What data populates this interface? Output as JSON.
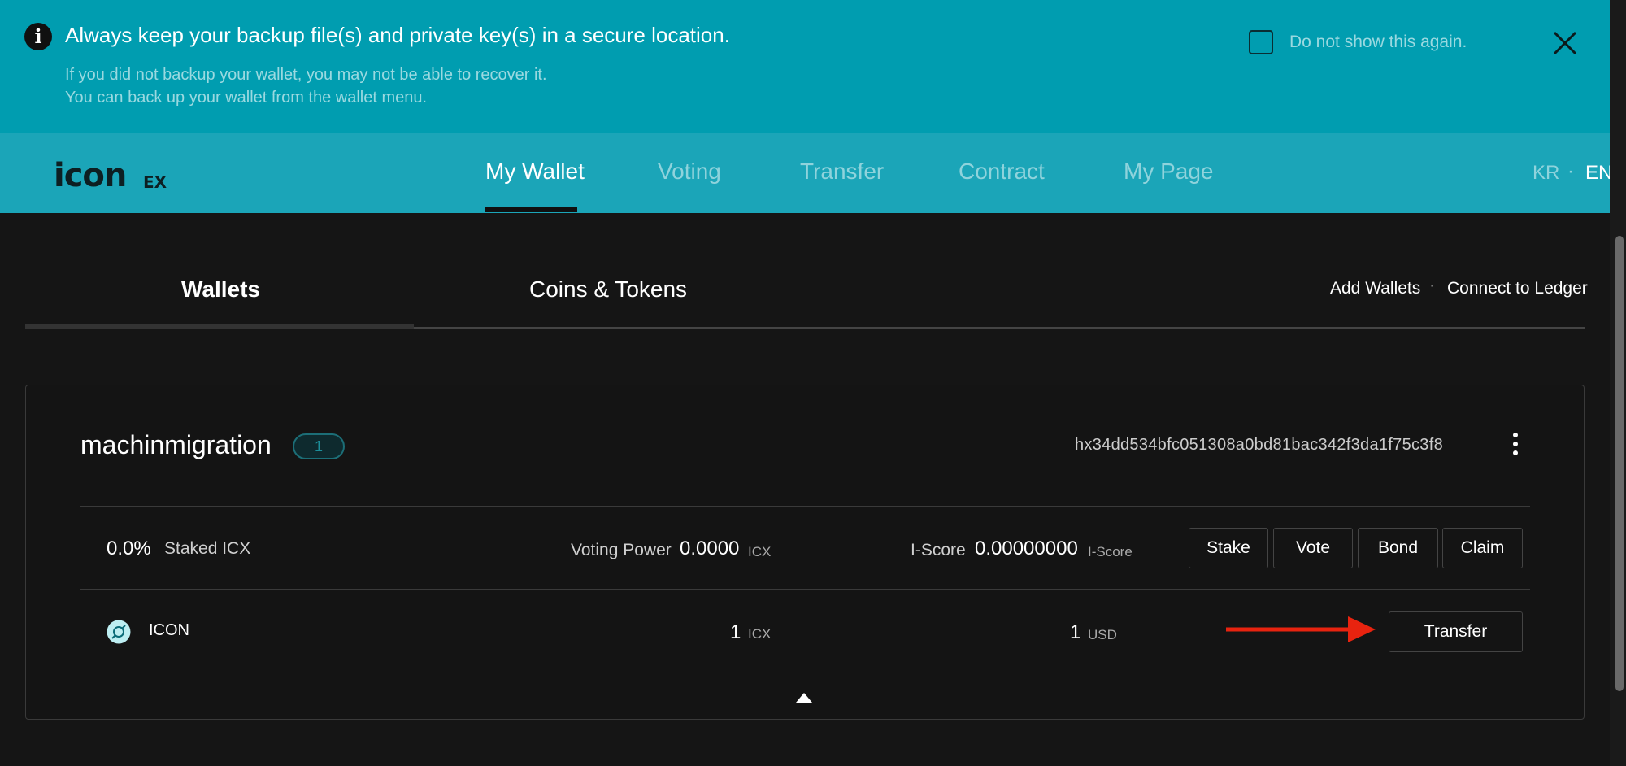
{
  "notice": {
    "title": "Always keep your backup file(s) and private key(s) in a secure location.",
    "line1": "If you did not backup your wallet, you may not be able to recover it.",
    "line2": "You can back up your wallet from the wallet menu.",
    "checkbox_label": "Do not show this again.",
    "checkbox_checked": false,
    "icons": {
      "info": "info-icon",
      "close": "close-icon"
    }
  },
  "header": {
    "logo_text": "icon",
    "logo_suffix": "EX",
    "nav": [
      "My Wallet",
      "Voting",
      "Transfer",
      "Contract",
      "My Page"
    ],
    "active_nav": "My Wallet",
    "lang": {
      "kr": "KR",
      "separator": "·",
      "en": "EN",
      "active": "EN"
    }
  },
  "subtabs": {
    "wallets": "Wallets",
    "coins_tokens": "Coins & Tokens",
    "active": "Wallets",
    "add_wallets": "Add Wallets",
    "separator": "·",
    "connect_ledger": "Connect to Ledger"
  },
  "wallet": {
    "name": "machinmigration",
    "count": "1",
    "address": "hx34dd534bfc051308a0bd81bac342f3da1f75c3f8",
    "staking": {
      "percent": "0.0%",
      "label": "Staked ICX",
      "voting_power_label": "Voting Power",
      "voting_power_value": "0.0000",
      "voting_power_unit": "ICX",
      "iscore_label": "I-Score",
      "iscore_value": "0.00000000",
      "iscore_unit": "I-Score",
      "buttons": {
        "stake": "Stake",
        "vote": "Vote",
        "bond": "Bond",
        "claim": "Claim"
      }
    },
    "coin": {
      "name": "ICON",
      "amount": "1",
      "amount_unit": "ICX",
      "usd": "1",
      "usd_unit": "USD",
      "transfer_button": "Transfer"
    }
  },
  "colors": {
    "banner": "#009db0",
    "header": "#1ba5b8",
    "background": "#151515",
    "arrow": "#e8230f"
  }
}
